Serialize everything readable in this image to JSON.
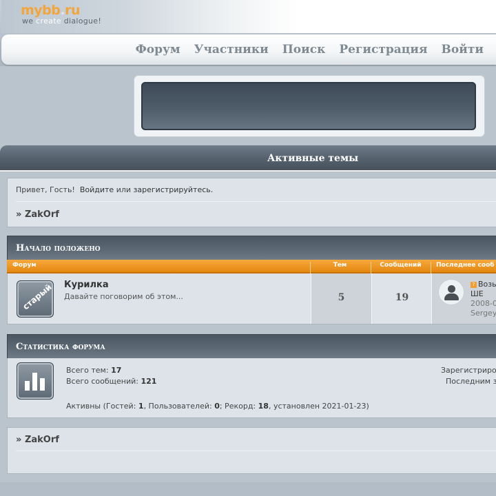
{
  "logo": {
    "name_part1": "mybb",
    "name_dot": ".",
    "name_part2": "ru",
    "tagline_1": "we",
    "tagline_2": "create",
    "tagline_3": "dialogue!"
  },
  "nav": [
    "Форум",
    "Участники",
    "Поиск",
    "Регистрация",
    "Войти"
  ],
  "active_topics_label": "Активные темы",
  "welcome": {
    "greeting": "Привет, Гость!",
    "login": "Войдите",
    "or": "или",
    "register": "зарегистрируйтесь."
  },
  "breadcrumb": {
    "prefix": "»",
    "forum": "ZakOrf"
  },
  "category": {
    "title": "Начало положено",
    "columns": {
      "forum": "Форум",
      "topics": "Тем",
      "posts": "Сообщений",
      "last_post": "Последнее сооб"
    },
    "forums": [
      {
        "icon_text": "старый",
        "name": "Курилка",
        "description": "Давайте поговорим об этом...",
        "topics": "5",
        "posts": "19",
        "last": {
          "topic": "Возь",
          "topic_line2": "ШЕ",
          "date": "2008-0",
          "user": "Sergey"
        }
      }
    ]
  },
  "stats": {
    "title": "Статистика форума",
    "total_topics_label": "Всего тем:",
    "total_topics": "17",
    "total_posts_label": "Всего сообщений:",
    "total_posts": "121",
    "registered_label": "Зарегистриро",
    "last_label": "Последним з",
    "active_label": "Активны",
    "guests_label": "(Гостей:",
    "guests": "1",
    "users_label": ", Пользователей:",
    "users": "0",
    "record_label": "; Рекорд:",
    "record": "18",
    "record_date": ", установлен 2021-01-23)"
  },
  "colors": {
    "accent_orange": "#e4870f",
    "header_dark": "#4a5661",
    "panel_bg": "#dde3e9"
  }
}
